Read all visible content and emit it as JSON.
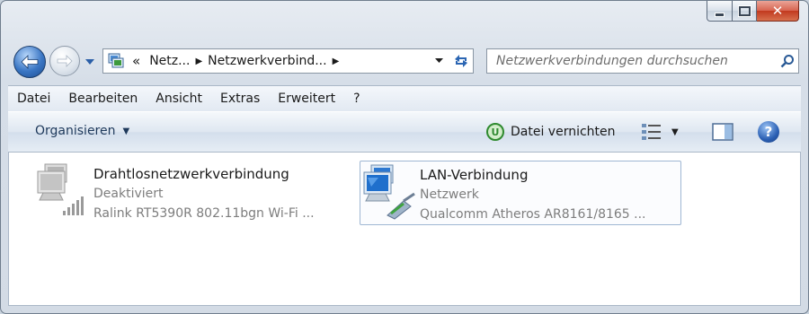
{
  "window": {
    "controls": {
      "minimize": "minimize",
      "maximize": "maximize",
      "close": "close"
    }
  },
  "address_bar": {
    "overflow": "«",
    "crumbs": [
      "Netz...",
      "Netzwerkverbind..."
    ],
    "separator": "▶"
  },
  "search": {
    "placeholder": "Netzwerkverbindungen durchsuchen"
  },
  "menu": {
    "items": [
      "Datei",
      "Bearbeiten",
      "Ansicht",
      "Extras",
      "Erweitert",
      "?"
    ]
  },
  "toolbar": {
    "organize_label": "Organisieren",
    "delete_label": "Datei vernichten",
    "help_label": "?"
  },
  "connections": [
    {
      "name": "Drahtlosnetzwerkverbindung",
      "status": "Deaktiviert",
      "device": "Ralink RT5390R 802.11bgn Wi-Fi ...",
      "icon": "wireless-adapter-icon",
      "enabled": false
    },
    {
      "name": "LAN-Verbindung",
      "status": "Netzwerk",
      "device": "Qualcomm Atheros AR8161/8165 ...",
      "icon": "lan-adapter-icon",
      "enabled": true
    }
  ],
  "colors": {
    "accent": "#2a5fb3",
    "selection_border": "#9fb7d3"
  }
}
